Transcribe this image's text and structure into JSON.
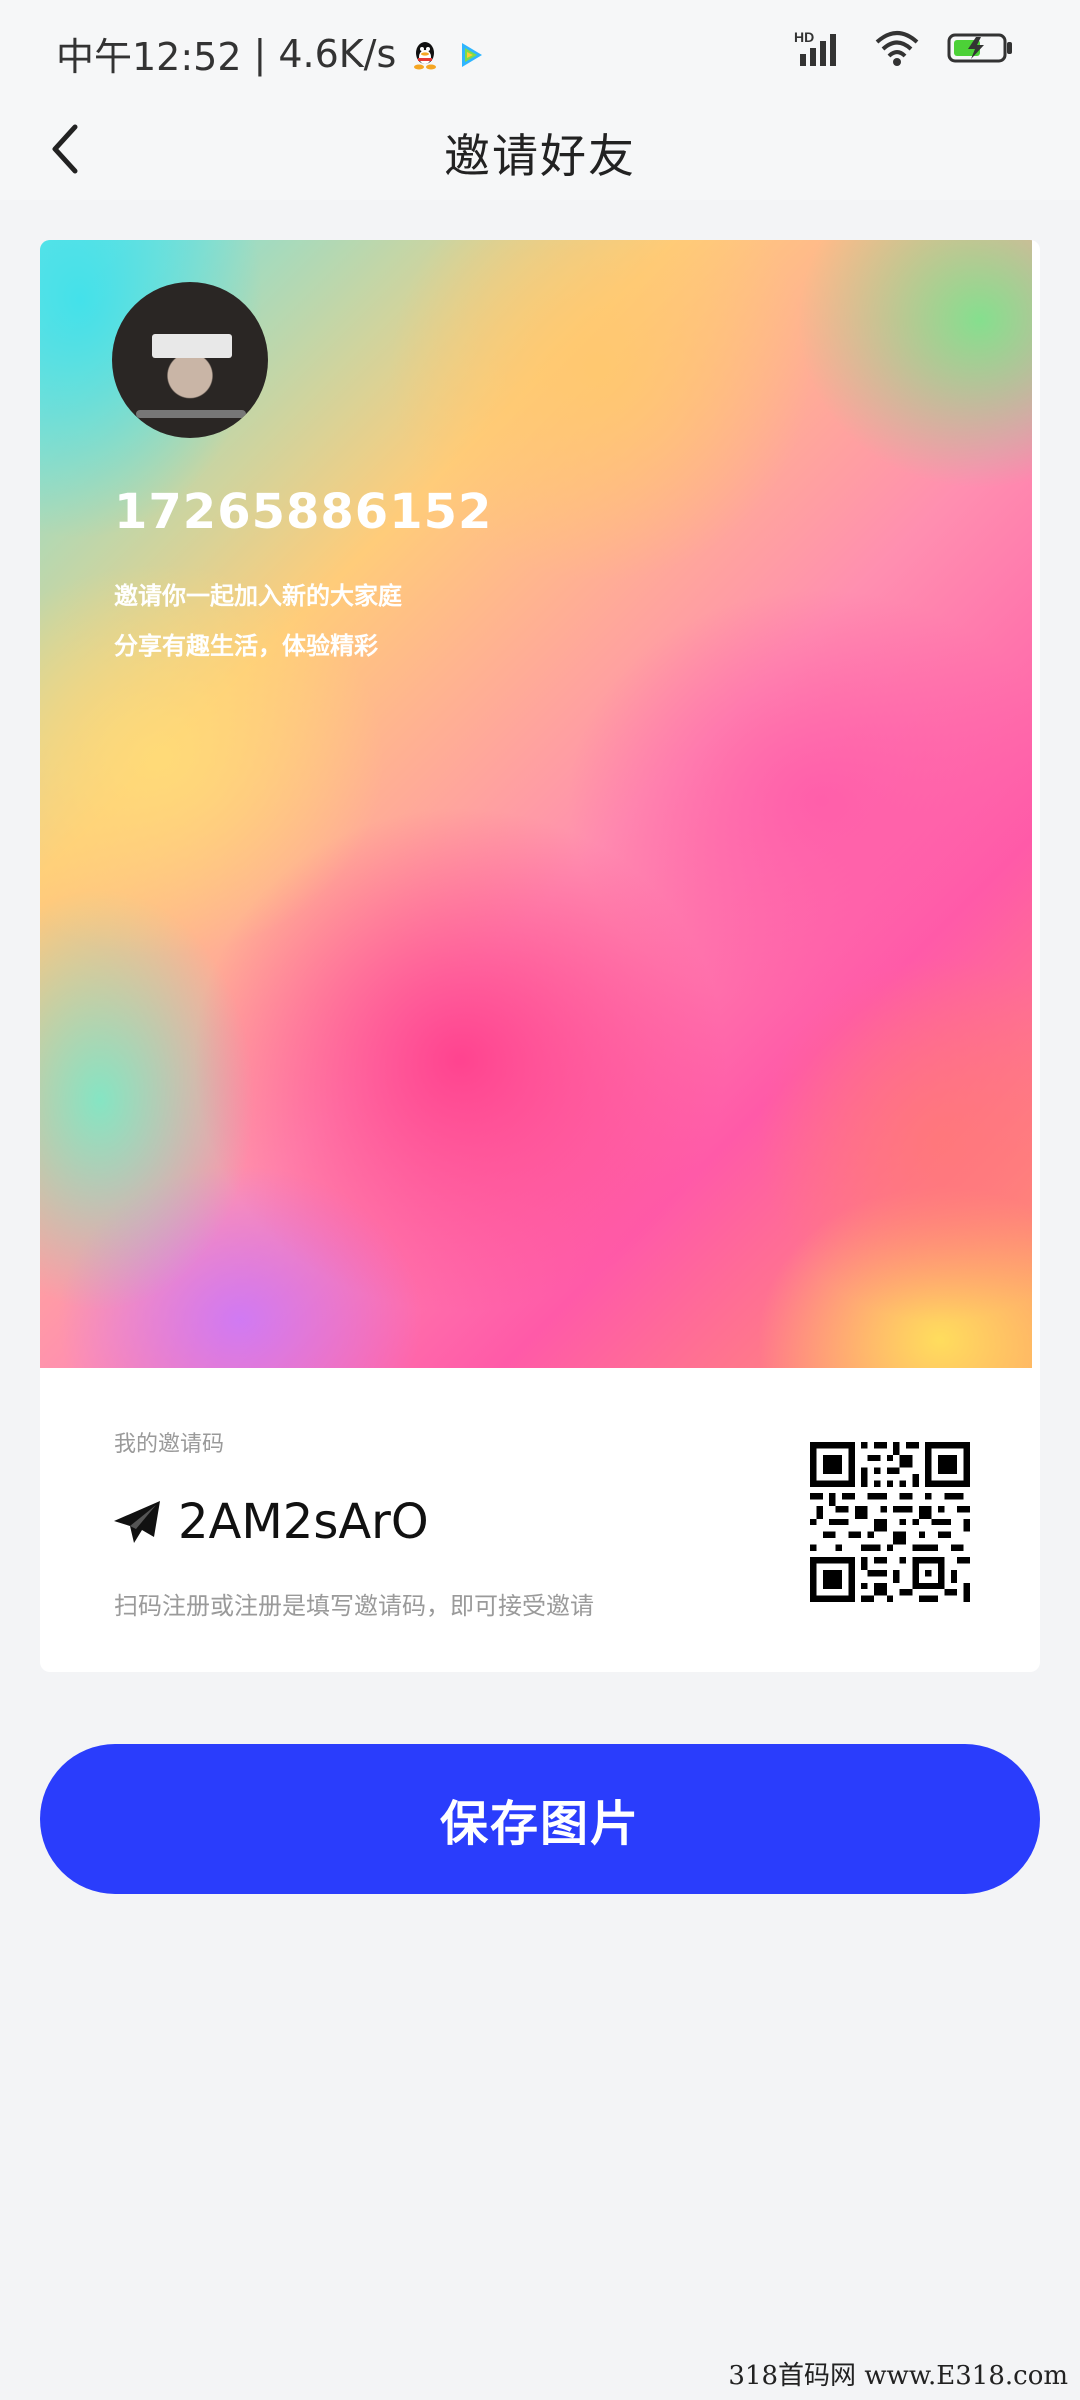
{
  "status_bar": {
    "time": "中午12:52",
    "separator": "|",
    "network_speed": "4.6K/s",
    "network_type": "HD",
    "icons": [
      "qq-icon",
      "video-app-icon",
      "signal-icon",
      "wifi-icon",
      "battery-charging-icon"
    ]
  },
  "nav": {
    "title": "邀请好友",
    "back_icon": "chevron-left-icon"
  },
  "poster": {
    "user_name": "17265886152",
    "line1": "邀请你一起加入新的大家庭",
    "line2": "分享有趣生活，体验精彩"
  },
  "invite": {
    "label": "我的邀请码",
    "code": "2AM2sArO",
    "hint": "扫码注册或注册是填写邀请码，即可接受邀请",
    "code_icon": "paper-plane-icon"
  },
  "actions": {
    "save_label": "保存图片"
  },
  "watermark": "318首码网 www.E318.com",
  "colors": {
    "accent": "#2a3dfc",
    "background": "#f3f4f6"
  }
}
